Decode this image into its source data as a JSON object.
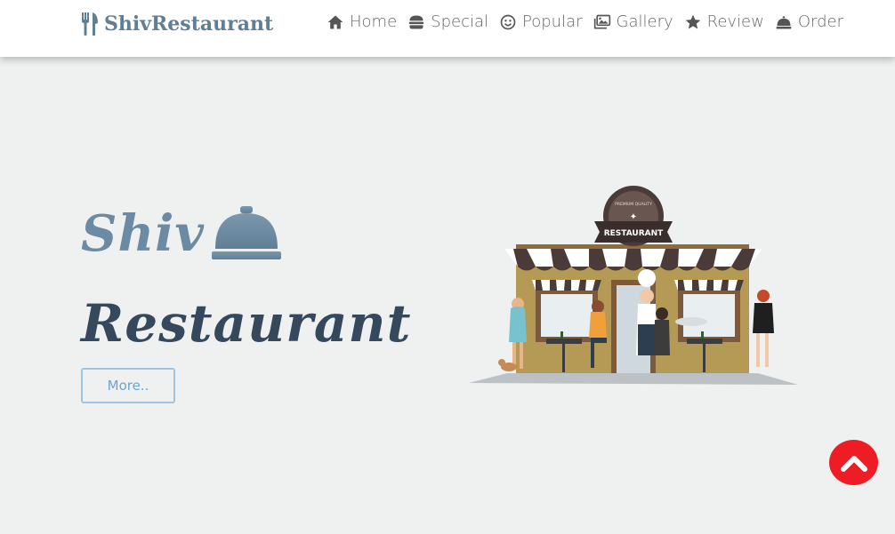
{
  "header": {
    "brand": "ShivRestaurant",
    "nav": [
      {
        "label": "Home",
        "icon": "home-icon"
      },
      {
        "label": "Special",
        "icon": "burger-icon"
      },
      {
        "label": "Popular",
        "icon": "smile-icon"
      },
      {
        "label": "Gallery",
        "icon": "images-icon"
      },
      {
        "label": "Review",
        "icon": "star-icon"
      },
      {
        "label": "Order",
        "icon": "concierge-bell-icon"
      }
    ]
  },
  "hero": {
    "title_line1": "Shiv",
    "title_line2": "Restaurant",
    "button": "More..",
    "image_sign": "RESTAURANT",
    "image_badge": "PREMIUM QUALITY"
  },
  "colors": {
    "brand": "#5f7f96",
    "title_light": "#6b8aa3",
    "title_dark": "#36495c",
    "button_border": "#9fc4e0",
    "scroll_top": "#ee1c25",
    "background": "#eff1f1"
  },
  "scroll_top_icon": "chevron-up-icon"
}
